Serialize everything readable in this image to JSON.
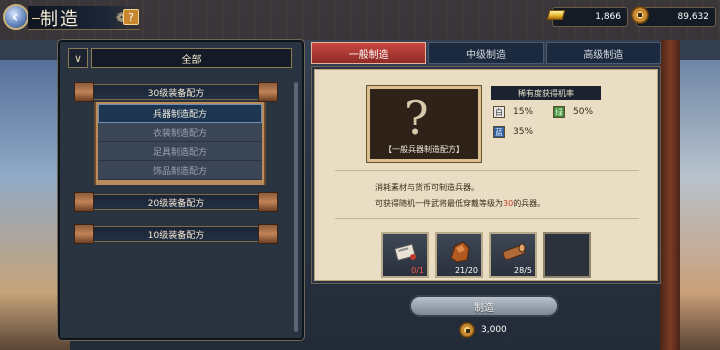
{
  "header": {
    "title": "制造",
    "help_label": "?"
  },
  "currency": {
    "gold": "1,866",
    "coins": "89,632"
  },
  "left_panel": {
    "all_tab": "全部",
    "collapse_glyph": "∨",
    "categories": [
      {
        "label": "30级装备配方",
        "expanded": true
      },
      {
        "label": "20级装备配方",
        "expanded": false
      },
      {
        "label": "10级装备配方",
        "expanded": false
      }
    ],
    "sub_items": [
      {
        "label": "兵器制造配方",
        "active": true
      },
      {
        "label": "衣装制造配方",
        "active": false
      },
      {
        "label": "足具制造配方",
        "active": false
      },
      {
        "label": "饰品制造配方",
        "active": false
      }
    ]
  },
  "tabs": [
    {
      "label": "一般制造",
      "active": true
    },
    {
      "label": "中级制造",
      "active": false
    },
    {
      "label": "高级制造",
      "active": false
    }
  ],
  "recipe": {
    "label": "【一般兵器制造配方】",
    "rarity_title": "稀有度获得机率",
    "rarities": [
      {
        "icon": "白",
        "value": "15%",
        "color": "white"
      },
      {
        "icon": "绿",
        "value": "50%",
        "color": "green"
      },
      {
        "icon": "蓝",
        "value": "35%",
        "color": "blue"
      }
    ],
    "desc_line1": "消耗素材与货币可制造兵器。",
    "desc_line2_a": "可获得随机一件武将最低穿戴等级为",
    "desc_line2_level": "30",
    "desc_line2_b": "的兵器。"
  },
  "materials": [
    {
      "name": "scroll",
      "count": "0/1",
      "insufficient": true
    },
    {
      "name": "ore",
      "count": "21/20",
      "insufficient": false
    },
    {
      "name": "wood",
      "count": "28/5",
      "insufficient": false
    },
    {
      "name": "empty",
      "count": "",
      "insufficient": false
    }
  ],
  "action": {
    "make_label": "制造",
    "cost": "3,000"
  }
}
